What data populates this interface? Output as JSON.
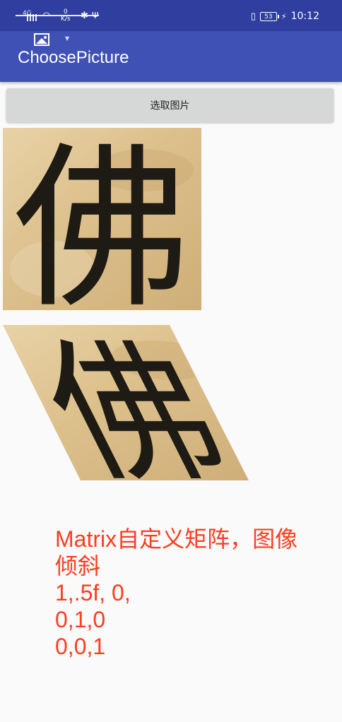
{
  "status_bar": {
    "signal_label": "4G",
    "speed_value": "0",
    "speed_unit": "K/s",
    "battery": "53",
    "time": "10:12"
  },
  "app_bar": {
    "title": "ChoosePicture"
  },
  "button": {
    "label": "选取图片"
  },
  "images": {
    "character": "佛"
  },
  "caption": {
    "lines": [
      "Matrix自定义矩阵，图像",
      "倾斜",
      "1,.5f, 0,",
      "0,1,0",
      "0,0,1"
    ]
  },
  "colors": {
    "status_bar_bg": "#303f9f",
    "app_bar_bg": "#3f51b5",
    "caption_text": "#ff3d1f",
    "button_bg": "#d6d7d7"
  }
}
